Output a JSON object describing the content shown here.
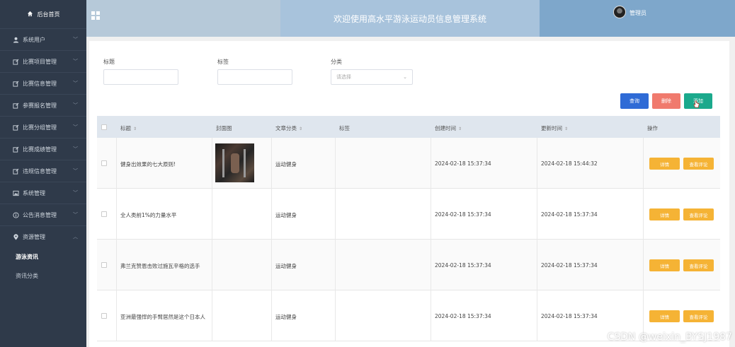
{
  "sidebar": {
    "home_label": "后台首页",
    "items": [
      {
        "label": "系统用户",
        "icon": "user-icon",
        "open": false
      },
      {
        "label": "比赛项目管理",
        "icon": "edit-icon",
        "open": false
      },
      {
        "label": "比赛信息管理",
        "icon": "edit-icon",
        "open": false
      },
      {
        "label": "参赛报名管理",
        "icon": "edit-icon",
        "open": false
      },
      {
        "label": "比赛分组管理",
        "icon": "edit-icon",
        "open": false
      },
      {
        "label": "比赛成绩管理",
        "icon": "edit-icon",
        "open": false
      },
      {
        "label": "违规信息管理",
        "icon": "edit-icon",
        "open": false
      },
      {
        "label": "系统管理",
        "icon": "picture-icon",
        "open": false
      },
      {
        "label": "公告消息管理",
        "icon": "info-icon",
        "open": false
      },
      {
        "label": "资源管理",
        "icon": "location-icon",
        "open": true
      }
    ],
    "subitems": [
      {
        "label": "游泳资讯",
        "active": true
      },
      {
        "label": "资讯分类",
        "active": false
      }
    ]
  },
  "header": {
    "title": "欢迎使用高水平游泳运动员信息管理系统",
    "admin_name": "管理员"
  },
  "search": {
    "title_label": "标题",
    "tag_label": "标签",
    "category_label": "分类",
    "category_placeholder": "请选择"
  },
  "toolbar": {
    "query_label": "查询",
    "delete_label": "删除",
    "add_label": "添加"
  },
  "table": {
    "headers": {
      "title": "标题",
      "cover": "封面图",
      "category": "文章分类",
      "tag": "标签",
      "created": "创建时间",
      "updated": "更新时间",
      "actions": "操作"
    },
    "detail_label": "详情",
    "comments_label": "查看评论",
    "rows": [
      {
        "title": "健身出效果的七大原则!",
        "category": "运动健身",
        "tag": "",
        "created": "2024-02-18 15:37:34",
        "updated": "2024-02-18 15:44:32",
        "has_cover": true
      },
      {
        "title": "全人类前1%的力量水平",
        "category": "运动健身",
        "tag": "",
        "created": "2024-02-18 15:37:34",
        "updated": "2024-02-18 15:37:34",
        "has_cover": false
      },
      {
        "title": "弗兰克赞恩击败过施瓦辛格的选手",
        "category": "运动健身",
        "tag": "",
        "created": "2024-02-18 15:37:34",
        "updated": "2024-02-18 15:37:34",
        "has_cover": false
      },
      {
        "title": "亚洲最强悍的手臂居然是这个日本人",
        "category": "运动健身",
        "tag": "",
        "created": "2024-02-18 15:37:34",
        "updated": "2024-02-18 15:37:34",
        "has_cover": false
      }
    ]
  },
  "watermark": "CSDN @weixin_BYSJ1987",
  "colors": {
    "sidebar_bg": "#2f3a4a",
    "header_center": "#a8c3dc",
    "query": "#2f6bd6",
    "delete": "#f07a6d",
    "add": "#1ba98c",
    "action": "#f5b335"
  }
}
